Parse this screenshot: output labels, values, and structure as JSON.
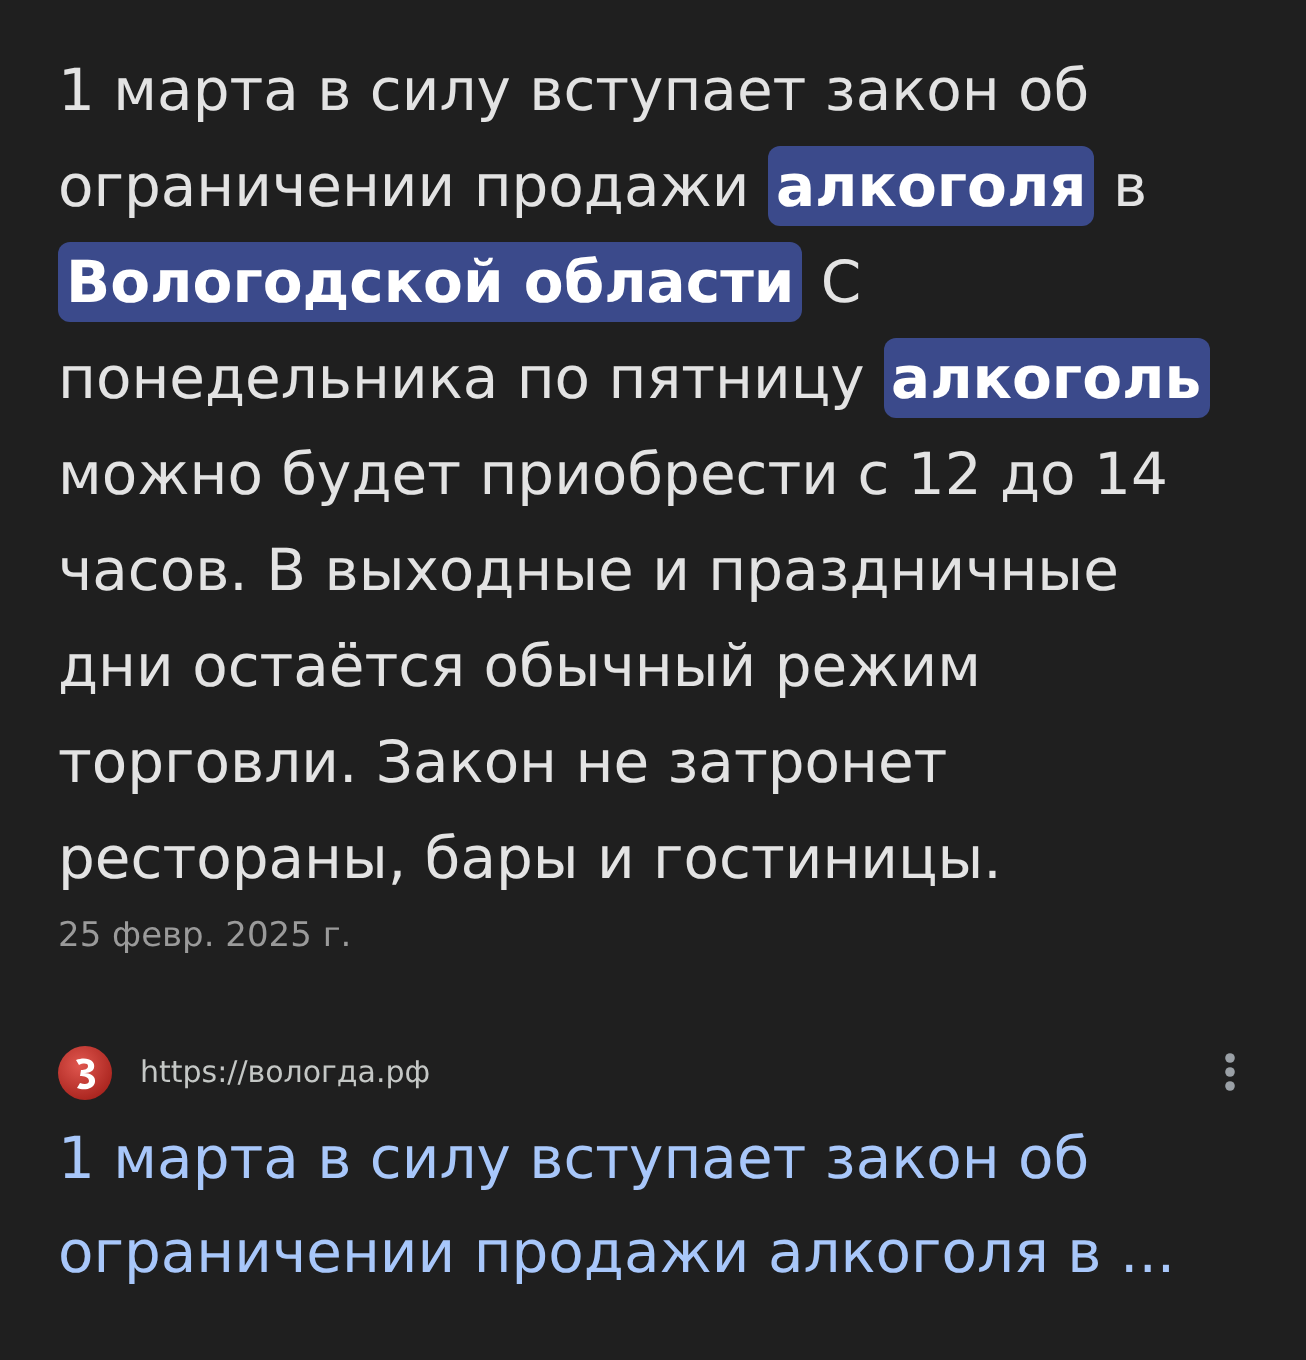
{
  "snippet": {
    "text": "1 марта в силу вступает закон об ограничении продажи **алкоголя** в **Вологодской области** С понедельника по пятницу **алкоголь** можно будет приобрести с 12 до 14 часов. В выходные и праздничные дни остаётся обычный режим торговли. Закон не затронет рестораны, бары и гостиницы.",
    "date": "25 февр. 2025 г."
  },
  "result": {
    "url": "https://вологда.рф",
    "title": "1 марта в силу вступает закон об ограничении продажи алкоголя в ..."
  }
}
